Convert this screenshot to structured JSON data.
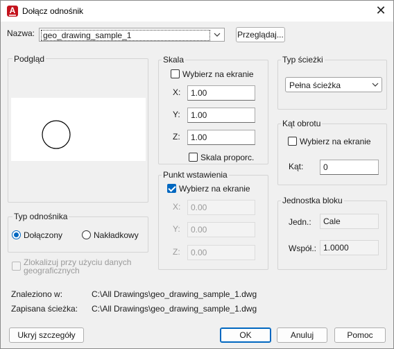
{
  "window": {
    "title": "Dołącz odnośnik",
    "app_icon": "A",
    "close_glyph": "✕"
  },
  "name": {
    "label": "Nazwa:",
    "value": "geo_drawing_sample_1",
    "browse_label": "Przeglądaj..."
  },
  "preview": {
    "title": "Podgląd"
  },
  "scale": {
    "title": "Skala",
    "pick_on_screen": "Wybierz na ekranie",
    "x_label": "X:",
    "x_value": "1.00",
    "y_label": "Y:",
    "y_value": "1.00",
    "z_label": "Z:",
    "z_value": "1.00",
    "uniform_label": "Skala proporc."
  },
  "insertion": {
    "title": "Punkt wstawienia",
    "pick_on_screen": "Wybierz na ekranie",
    "pick_checked": true,
    "x_label": "X:",
    "x_value": "0.00",
    "y_label": "Y:",
    "y_value": "0.00",
    "z_label": "Z:",
    "z_value": "0.00"
  },
  "path_type": {
    "title": "Typ ścieżki",
    "value": "Pełna ścieżka"
  },
  "rotation": {
    "title": "Kąt obrotu",
    "pick_on_screen": "Wybierz na ekranie",
    "angle_label": "Kąt:",
    "angle_value": "0"
  },
  "block_unit": {
    "title": "Jednostka bloku",
    "unit_label": "Jedn.:",
    "unit_value": "Cale",
    "factor_label": "Współ.:",
    "factor_value": "1.0000"
  },
  "reference_type": {
    "title": "Typ odnośnika",
    "attached": "Dołączony",
    "overlay": "Nakładkowy"
  },
  "geo": {
    "label_line1": "Zlokalizuj przy użyciu danych",
    "label_line2": "geograficznych"
  },
  "info": {
    "found_label": "Znaleziono w:",
    "found_value": "C:\\All Drawings\\geo_drawing_sample_1.dwg",
    "saved_label": "Zapisana ścieżka:",
    "saved_value": "C:\\All Drawings\\geo_drawing_sample_1.dwg"
  },
  "buttons": {
    "hide_details": "Ukryj szczegóły",
    "ok": "OK",
    "cancel": "Anuluj",
    "help": "Pomoc"
  },
  "colors": {
    "accent": "#0067c0",
    "app_icon": "#c4131d"
  }
}
